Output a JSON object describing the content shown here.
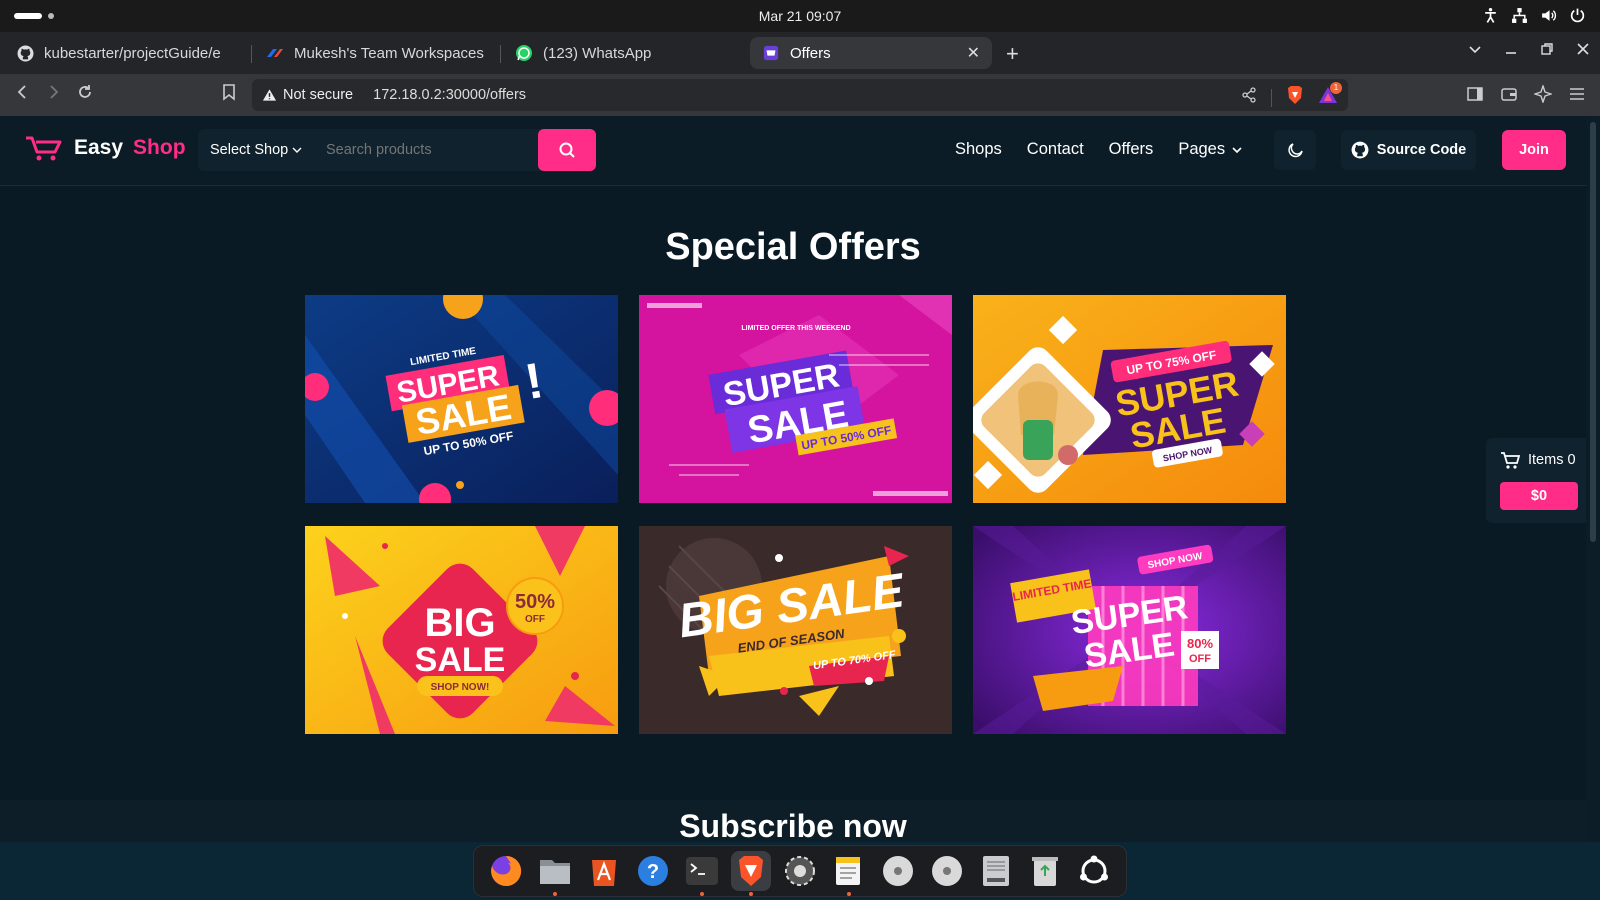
{
  "system": {
    "clock": "Mar 21  09:07"
  },
  "browser": {
    "tabs": [
      {
        "label": "kubestarter/projectGuide/e",
        "icon": "github-icon"
      },
      {
        "label": "Mukesh's Team Workspaces",
        "icon": "postman-icon"
      },
      {
        "label": "(123) WhatsApp",
        "icon": "whatsapp-icon"
      },
      {
        "label": "Offers",
        "icon": "easy-shop-favicon",
        "active": true
      }
    ],
    "security_label": "Not secure",
    "url": "172.18.0.2:30000/offers",
    "brave_rewards_count": "1"
  },
  "site": {
    "logo_easy": "Easy",
    "logo_shop": "Shop",
    "select_shop": "Select Shop",
    "search_placeholder": "Search products",
    "nav": {
      "shops": "Shops",
      "contact": "Contact",
      "offers": "Offers",
      "pages": "Pages"
    },
    "source_code": "Source Code",
    "join": "Join"
  },
  "offers_page": {
    "title": "Special Offers",
    "banners": [
      {
        "small": "LIMITED TIME",
        "main1": "SUPER",
        "main2": "SALE",
        "tag": "UP TO 50% OFF"
      },
      {
        "small": "LIMITED OFFER THIS WEEKEND",
        "main1": "SUPER",
        "main2": "SALE",
        "tag": "UP TO 50% OFF"
      },
      {
        "small": "UP TO 75% OFF",
        "main1": "SUPER",
        "main2": "SALE",
        "tag": "SHOP NOW"
      },
      {
        "small": "50%",
        "small2": "OFF",
        "main1": "BIG",
        "main2": "SALE",
        "tag": "SHOP NOW!"
      },
      {
        "small": "END OF SEASON",
        "main1": "BIG SALE",
        "main2": "",
        "tag": "UP TO 70% OFF"
      },
      {
        "small": "LIMITED TIME",
        "main1": "SUPER",
        "main2": "SALE",
        "tag": "SHOP NOW",
        "extra": "80%",
        "extra2": "OFF"
      }
    ],
    "subscribe_title": "Subscribe now"
  },
  "cart": {
    "items_label": "Items 0",
    "total": "$0"
  },
  "dock": {
    "apps": [
      "firefox-icon",
      "files-icon",
      "app-center-icon",
      "help-icon",
      "terminal-icon",
      "brave-icon",
      "settings-icon",
      "text-editor-icon",
      "disc-icon",
      "disc-icon",
      "drive-icon",
      "trash-icon",
      "app-grid-icon"
    ]
  },
  "colors": {
    "accent": "#ff2d88",
    "page_bg": "#0a1a24",
    "header_bg": "#0c1c26"
  }
}
